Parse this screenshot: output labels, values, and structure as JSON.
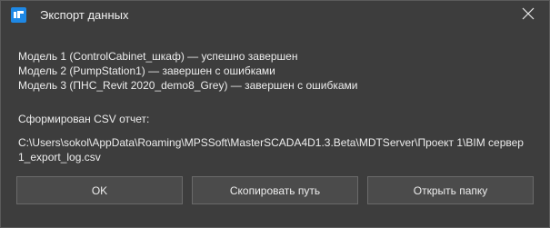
{
  "window": {
    "title": "Экспорт данных",
    "icon": "mps-app-icon",
    "close_icon": "close-icon"
  },
  "results": [
    "Модель 1 (ControlCabinet_шкаф) — успешно завершен",
    "Модель 2 (PumpStation1) — завершен с ошибками",
    "Модель 3 (ПНС_Revit 2020_demo8_Grey) — завершен с ошибками"
  ],
  "report": {
    "label": "Сформирован CSV отчет:",
    "path_line1": "C:\\Users\\sokol\\AppData\\Roaming\\MPSSoft\\MasterSCADA4D1.3.Beta\\MDTServer\\Проект 1\\BIM сервер",
    "path_line2": "1_export_log.csv"
  },
  "buttons": {
    "ok": "OK",
    "copy_path": "Скопировать путь",
    "open_folder": "Открыть папку"
  },
  "colors": {
    "background": "#3d3d3d",
    "text": "#ececec",
    "button": "#4b4b4b",
    "icon_blue": "#1e88e5"
  }
}
